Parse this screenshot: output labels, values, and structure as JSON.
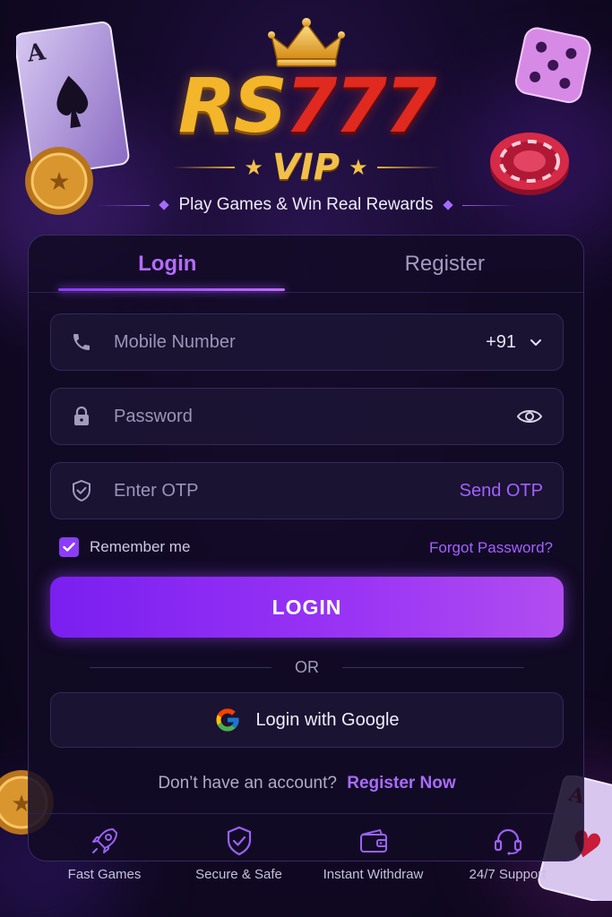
{
  "brand": {
    "name_part1": "RS",
    "name_part2": "777",
    "sub": "VIP",
    "tagline": "Play Games & Win Real Rewards"
  },
  "tabs": [
    {
      "label": "Login",
      "active": true
    },
    {
      "label": "Register",
      "active": false
    }
  ],
  "form": {
    "mobile_placeholder": "Mobile Number",
    "country_code": "+91",
    "password_placeholder": "Password",
    "otp_placeholder": "Enter OTP",
    "send_otp_label": "Send OTP",
    "remember_label": "Remember me",
    "remember_checked": true,
    "forgot_label": "Forgot Password?",
    "login_button": "LOGIN",
    "or_label": "OR",
    "google_button": "Login with Google",
    "signup_prompt": "Don’t have an account?",
    "signup_link": "Register Now"
  },
  "features": [
    {
      "icon": "rocket-icon",
      "label": "Fast Games"
    },
    {
      "icon": "shield-check-icon",
      "label": "Secure & Safe"
    },
    {
      "icon": "wallet-icon",
      "label": "Instant Withdraw"
    },
    {
      "icon": "headset-icon",
      "label": "24/7 Support"
    }
  ],
  "colors": {
    "accent": "#a261ff",
    "button_gradient_start": "#7a1ff0",
    "button_gradient_end": "#b14df0",
    "gold": "#f3b52a",
    "red": "#e0291f",
    "background": "#140a2a"
  }
}
